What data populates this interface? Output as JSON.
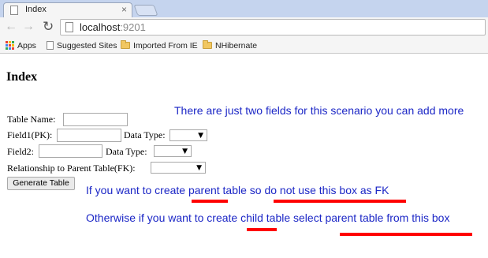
{
  "browser": {
    "tab_title": "Index",
    "tab_close": "×",
    "url_host": "localhost",
    "url_port": ":9201",
    "nav": {
      "back": "←",
      "forward": "→",
      "reload": "↻"
    }
  },
  "bookmarks": [
    {
      "label": "Apps",
      "icon": "apps-grid-icon"
    },
    {
      "label": "Suggested Sites",
      "icon": "page-icon"
    },
    {
      "label": "Imported From IE",
      "icon": "folder-icon"
    },
    {
      "label": "NHibernate",
      "icon": "folder-icon"
    }
  ],
  "page": {
    "title": "Index",
    "form": {
      "table_name_label": "Table Name:",
      "field1_label": "Field1(PK):",
      "field1_type_label": "Data Type:",
      "field2_label": "Field2:",
      "field2_type_label": "Data Type:",
      "relationship_label": "Relationship to Parent Table(FK):",
      "generate_button": "Generate Table"
    }
  },
  "annotations": {
    "note1": "There are just two fields for this scenario you can add more",
    "note2": "If you want to create parent table so do not use this box as FK",
    "note3": "Otherwise if you want to create child table select parent table from this box",
    "color": "#1c27c6",
    "underline_color": "#ff0000"
  }
}
